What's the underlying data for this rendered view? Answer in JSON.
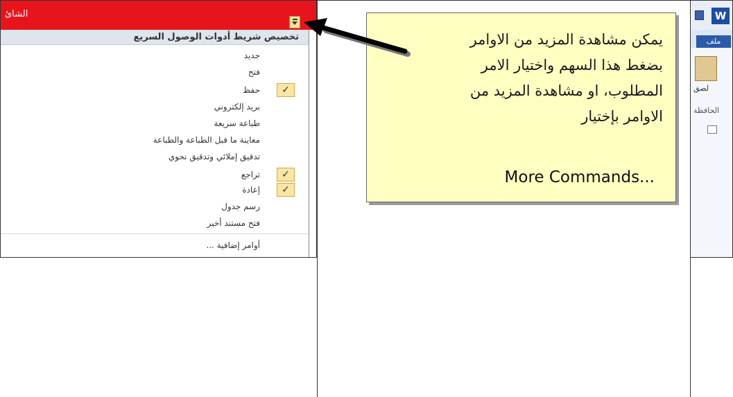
{
  "qat": {
    "title": "الشائ",
    "menu_header": "تخصيص شريط أدوات الوصول السريع",
    "items": [
      {
        "label": "جديد",
        "checked": false
      },
      {
        "label": "فتح",
        "checked": false
      },
      {
        "label": "حفظ",
        "checked": true
      },
      {
        "label": "بريد إلكتروني",
        "checked": false
      },
      {
        "label": "طباعة سريعة",
        "checked": false
      },
      {
        "label": "معاينة ما قبل الطباعة والطباعة",
        "checked": false
      },
      {
        "label": "تدقيق إملائي وتدقيق نحوي",
        "checked": false
      },
      {
        "label": "تراجع",
        "checked": true
      },
      {
        "label": "إعادة",
        "checked": true
      },
      {
        "label": "رسم جدول",
        "checked": false
      },
      {
        "label": "فتح مستند أخير",
        "checked": false
      },
      {
        "label": "أوامر إضافية ...",
        "checked": false
      }
    ],
    "check_glyph": "✓"
  },
  "callout": {
    "lines": [
      "يمكن مشاهدة المزيد من الاوامر",
      "بضغط هذا السهم واختيار الامر",
      "المطلوب، او مشاهدة المزيد من",
      "الاوامر بإختيار"
    ],
    "command": "More Commands..."
  },
  "word": {
    "app_icon_letter": "W",
    "file_tab": "ملف",
    "paste_label": "لصق",
    "clipboard_label": "الحافظة"
  },
  "colors": {
    "titlebar_red": "#e8141c",
    "callout_bg": "#ffffc2",
    "check_bg": "#fbe5a3"
  }
}
